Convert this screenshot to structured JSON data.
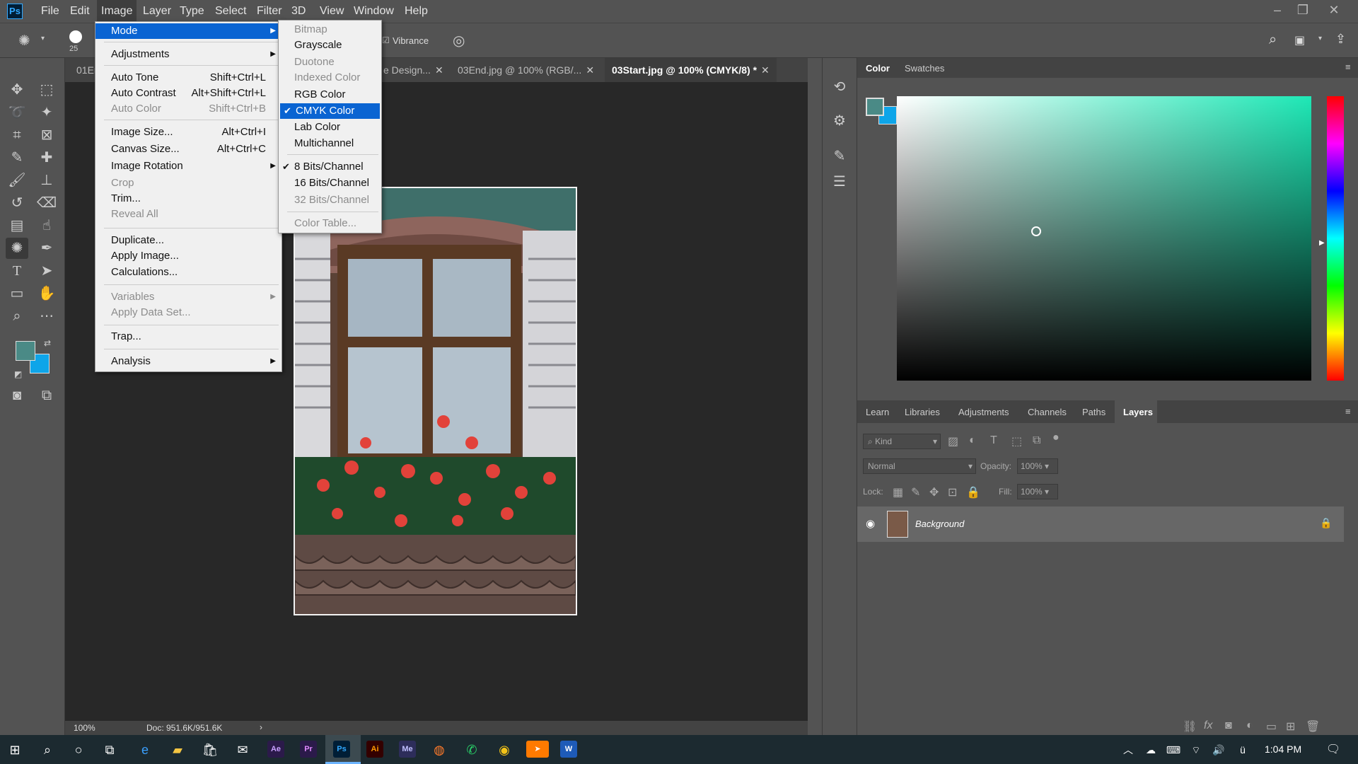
{
  "menubar": {
    "items": [
      "File",
      "Edit",
      "Image",
      "Layer",
      "Type",
      "Select",
      "Filter",
      "3D",
      "View",
      "Window",
      "Help"
    ],
    "logo": "Ps"
  },
  "options": {
    "brush_size": "25",
    "vibrance_label": "Vibrance"
  },
  "tabs": [
    {
      "label": "01En"
    },
    {
      "label": "e Design..."
    },
    {
      "label": "03End.jpg @ 100% (RGB/..."
    },
    {
      "label": "03Start.jpg @ 100% (CMYK/8) *"
    }
  ],
  "image_menu": {
    "items": [
      {
        "label": "Mode",
        "shortcut": "",
        "submenu": true,
        "state": "highlighted"
      },
      {
        "label": "Adjustments",
        "shortcut": "",
        "submenu": true,
        "state": "normal"
      },
      {
        "label": "Auto Tone",
        "shortcut": "Shift+Ctrl+L",
        "state": "normal"
      },
      {
        "label": "Auto Contrast",
        "shortcut": "Alt+Shift+Ctrl+L",
        "state": "normal"
      },
      {
        "label": "Auto Color",
        "shortcut": "Shift+Ctrl+B",
        "state": "disabled"
      },
      {
        "label": "Image Size...",
        "shortcut": "Alt+Ctrl+I",
        "state": "normal"
      },
      {
        "label": "Canvas Size...",
        "shortcut": "Alt+Ctrl+C",
        "state": "normal"
      },
      {
        "label": "Image Rotation",
        "shortcut": "",
        "submenu": true,
        "state": "normal"
      },
      {
        "label": "Crop",
        "shortcut": "",
        "state": "disabled"
      },
      {
        "label": "Trim...",
        "shortcut": "",
        "state": "normal"
      },
      {
        "label": "Reveal All",
        "shortcut": "",
        "state": "disabled"
      },
      {
        "label": "Duplicate...",
        "shortcut": "",
        "state": "normal"
      },
      {
        "label": "Apply Image...",
        "shortcut": "",
        "state": "normal"
      },
      {
        "label": "Calculations...",
        "shortcut": "",
        "state": "normal"
      },
      {
        "label": "Variables",
        "shortcut": "",
        "submenu": true,
        "state": "disabled"
      },
      {
        "label": "Apply Data Set...",
        "shortcut": "",
        "state": "disabled"
      },
      {
        "label": "Trap...",
        "shortcut": "",
        "state": "normal"
      },
      {
        "label": "Analysis",
        "shortcut": "",
        "submenu": true,
        "state": "normal"
      }
    ]
  },
  "mode_menu": {
    "items": [
      {
        "label": "Bitmap",
        "state": "disabled"
      },
      {
        "label": "Grayscale",
        "state": "normal"
      },
      {
        "label": "Duotone",
        "state": "disabled"
      },
      {
        "label": "Indexed Color",
        "state": "disabled"
      },
      {
        "label": "RGB Color",
        "state": "normal"
      },
      {
        "label": "CMYK Color",
        "state": "highlighted",
        "checked": true
      },
      {
        "label": "Lab Color",
        "state": "normal"
      },
      {
        "label": "Multichannel",
        "state": "normal"
      },
      {
        "label": "8 Bits/Channel",
        "state": "normal",
        "checked": true
      },
      {
        "label": "16 Bits/Channel",
        "state": "normal"
      },
      {
        "label": "32 Bits/Channel",
        "state": "disabled"
      },
      {
        "label": "Color Table...",
        "state": "disabled"
      }
    ]
  },
  "status": {
    "zoom": "100%",
    "doc": "Doc: 951.6K/951.6K"
  },
  "color_panel": {
    "tabs": [
      "Color",
      "Swatches"
    ],
    "fg_color": "#4a8a86",
    "bg_color": "#0ea5e9"
  },
  "layers_panel": {
    "tabs": [
      "Learn",
      "Libraries",
      "Adjustments",
      "Channels",
      "Paths",
      "Layers"
    ],
    "kind_label": "Kind",
    "blend_mode": "Normal",
    "opacity_label": "Opacity:",
    "opacity_value": "100%",
    "lock_label": "Lock:",
    "fill_label": "Fill:",
    "fill_value": "100%",
    "layer_name": "Background"
  },
  "taskbar": {
    "time": "1:04 PM"
  }
}
